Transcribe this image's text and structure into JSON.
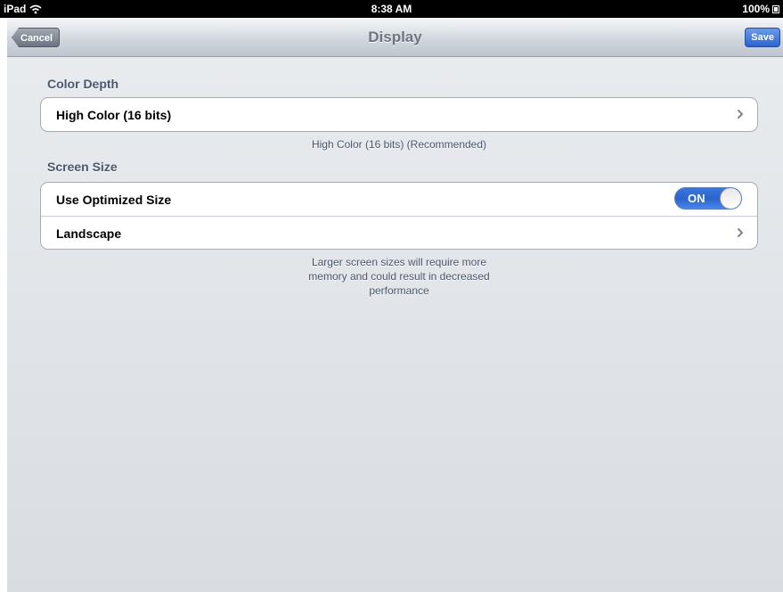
{
  "status_bar": {
    "device": "iPad",
    "time": "8:38 AM",
    "battery": "100%"
  },
  "nav": {
    "title": "Display",
    "cancel_label": "Cancel",
    "save_label": "Save"
  },
  "color_depth": {
    "header": "Color Depth",
    "value": "High Color (16 bits)",
    "footer": "High Color (16 bits) (Recommended)"
  },
  "screen_size": {
    "header": "Screen Size",
    "optimized_label": "Use Optimized Size",
    "toggle_state": "ON",
    "orientation_label": "Landscape",
    "footer_line1": "Larger screen sizes will require more",
    "footer_line2": "memory and could result in decreased",
    "footer_line3": "performance"
  },
  "icons": {
    "wifi": "wifi-icon",
    "battery": "battery-icon",
    "chevron": "chevron-right-icon"
  },
  "colors": {
    "accent": "#2d63cf",
    "background": "#dfe2e6",
    "section_text": "#4c566c"
  }
}
